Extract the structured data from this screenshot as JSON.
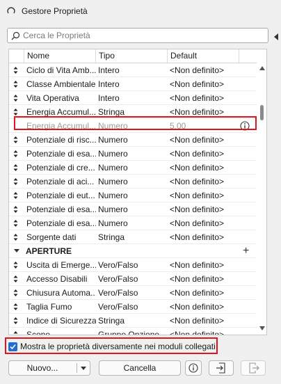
{
  "window": {
    "title": "Gestore Proprietà"
  },
  "search": {
    "placeholder": "Cerca le Proprietà"
  },
  "columns": {
    "name": "Nome",
    "type": "Tipo",
    "default": "Default"
  },
  "rows": [
    {
      "name": "Ciclo di Vita Amb...",
      "type": "Intero",
      "default": "<Non definito>"
    },
    {
      "name": "Classe Ambientale",
      "type": "Intero",
      "default": "<Non definito>"
    },
    {
      "name": "Vita Operativa",
      "type": "Intero",
      "default": "<Non definito>"
    },
    {
      "name": "Energia Accumul...",
      "type": "Stringa",
      "default": "<Non definito>"
    },
    {
      "name": "Energia Accumul...",
      "type": "Numero",
      "default": "5,00"
    },
    {
      "name": "Potenziale di risc...",
      "type": "Numero",
      "default": "<Non definito>"
    },
    {
      "name": "Potenziale di esa...",
      "type": "Numero",
      "default": "<Non definito>"
    },
    {
      "name": "Potenziale di cre...",
      "type": "Numero",
      "default": "<Non definito>"
    },
    {
      "name": "Potenziale di aci...",
      "type": "Numero",
      "default": "<Non definito>"
    },
    {
      "name": "Potenziale di eut...",
      "type": "Numero",
      "default": "<Non definito>"
    },
    {
      "name": "Potenziale di esa...",
      "type": "Numero",
      "default": "<Non definito>"
    },
    {
      "name": "Potenziale di esa...",
      "type": "Numero",
      "default": "<Non definito>"
    },
    {
      "name": "Sorgente dati",
      "type": "Stringa",
      "default": "<Non definito>"
    },
    {
      "group": "APERTURE"
    },
    {
      "name": "Uscita di Emerge...",
      "type": "Vero/Falso",
      "default": "<Non definito>"
    },
    {
      "name": "Accesso Disabili",
      "type": "Vero/Falso",
      "default": "<Non definito>"
    },
    {
      "name": "Chiusura Automa...",
      "type": "Vero/Falso",
      "default": "<Non definito>"
    },
    {
      "name": "Taglia Fumo",
      "type": "Vero/Falso",
      "default": "<Non definito>"
    },
    {
      "name": "Indice di Sicurezza",
      "type": "Stringa",
      "default": "<Non definito>"
    },
    {
      "name": "Scopo",
      "type": "Gruppo Opzione",
      "default": "<Non definito>"
    }
  ],
  "checkbox": {
    "label": "Mostra le proprietà diversamente nei moduli collegati",
    "checked": true
  },
  "buttons": {
    "new": "Nuovo...",
    "cancel": "Cancella"
  },
  "colors": {
    "accent": "#1f6fd1",
    "highlight": "#e0141c"
  }
}
